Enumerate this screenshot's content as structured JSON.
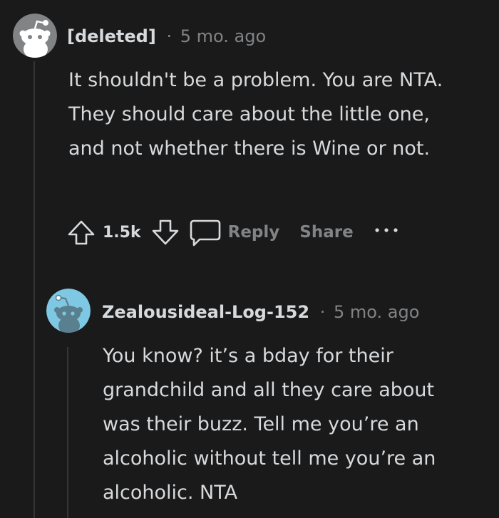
{
  "comments": [
    {
      "author": "[deleted]",
      "separator": "·",
      "timestamp": "5 mo. ago",
      "avatar_icon": "snoo-grey-avatar-icon",
      "body": "It shouldn't be a problem. You are NTA. They should care about the little one, and not whether there is Wine or not.",
      "score": "1.5k"
    },
    {
      "author": "Zealousideal-Log-152",
      "separator": "·",
      "timestamp": "5 mo. ago",
      "avatar_icon": "snoo-blue-avatar-icon",
      "body": "You know? it’s a bday for their grandchild and all they care about was their buzz. Tell me you’re an alcoholic without tell me you’re an alcoholic. NTA"
    }
  ],
  "actions": {
    "upvote_icon": "upvote-arrow-icon",
    "downvote_icon": "downvote-arrow-icon",
    "comment_icon": "comment-bubble-icon",
    "reply_label": "Reply",
    "share_label": "Share",
    "more_icon": "ellipsis-icon"
  },
  "colors": {
    "background": "#1a1a1b",
    "text": "#d7dadc",
    "muted": "#818384",
    "thread_line": "#343536",
    "avatar_grey_bg": "#818384",
    "avatar_blue_bg": "#7ec8e3"
  }
}
